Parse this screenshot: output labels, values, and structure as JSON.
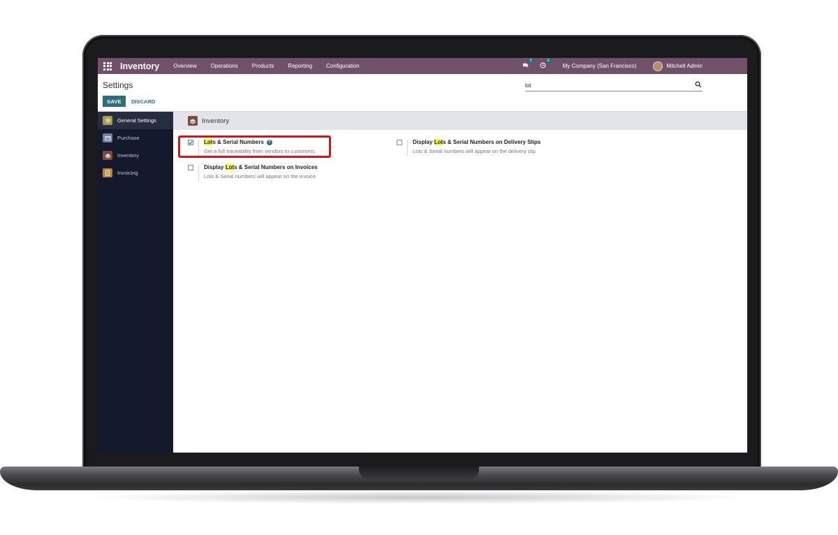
{
  "navbar": {
    "app_name": "Inventory",
    "menu": [
      "Overview",
      "Operations",
      "Products",
      "Reporting",
      "Configuration"
    ],
    "messages_count": "5",
    "activities_count": "6",
    "company": "My Company (San Francisco)",
    "user": "Mitchell Admin"
  },
  "control_panel": {
    "title": "Settings",
    "save_label": "SAVE",
    "discard_label": "DISCARD",
    "search_value": "lot"
  },
  "sidebar": {
    "items": [
      {
        "label": "General Settings",
        "icon": "gear-icon",
        "color": "#a89a4c"
      },
      {
        "label": "Purchase",
        "icon": "purchase-card-icon",
        "color": "#6b7fa6"
      },
      {
        "label": "Inventory",
        "icon": "inventory-box-icon",
        "color": "#7b4b3f"
      },
      {
        "label": "Invoicing",
        "icon": "invoice-doc-icon",
        "color": "#b8813d"
      }
    ]
  },
  "section": {
    "title": "Inventory"
  },
  "settings": [
    {
      "title_hl": "Lot",
      "title_rest": "s & Serial Numbers",
      "description": "Get a full traceability from vendors to customers",
      "checked": true
    },
    {
      "title_pre": "Display ",
      "title_hl": "Lot",
      "title_rest": "s & Serial Numbers on Delivery Slips",
      "description": "Lots & Serial numbers will appear on the delivery slip",
      "checked": false
    },
    {
      "title_pre": "Display ",
      "title_hl": "Lot",
      "title_rest": "s & Serial Numbers on Invoices",
      "description": "Lots & Serial numbers will appear on the invoice",
      "checked": false
    }
  ],
  "colors": {
    "navbar": "#71506a",
    "primary": "#2d6f79",
    "sidebar": "#141a2b",
    "highlight": "#f5f53a",
    "annotation": "#d0151a"
  }
}
